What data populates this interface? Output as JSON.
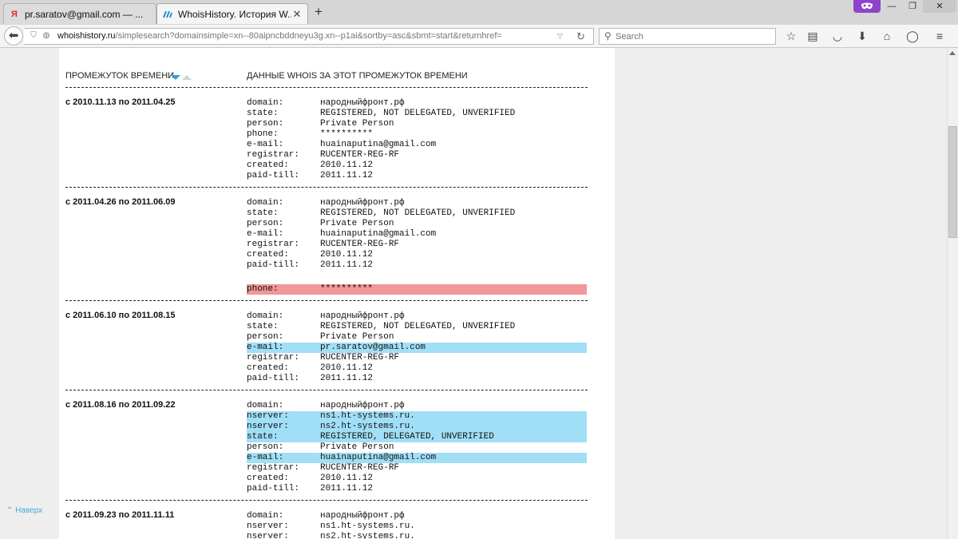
{
  "tabs": [
    {
      "label": "pr.saratov@gmail.com — ...",
      "favicon": "yandex-icon",
      "active": false
    },
    {
      "label": "WhoisHistory. История W...",
      "favicon": "whoishistory-icon",
      "active": true
    }
  ],
  "window_controls": {
    "minimize": "—",
    "restore": "❐",
    "close": "✕"
  },
  "url": {
    "host": "whoishistory.ru",
    "path": "/simplesearch?domainsimple=xn--80aipncbddneyu3g.xn--p1ai&sortby=asc&sbmt=start&returnhref="
  },
  "search": {
    "placeholder": "Search"
  },
  "toolbar_icons": [
    "bookmark-star-icon",
    "reading-list-icon",
    "pocket-icon",
    "download-icon",
    "home-icon",
    "chat-icon",
    "menu-icon"
  ],
  "table": {
    "col_period": "ПРОМЕЖУТОК ВРЕМЕНИ",
    "col_data": "ДАННЫЕ WHOIS ЗА ЭТОТ ПРОМЕЖУТОК ВРЕМЕНИ"
  },
  "records": [
    {
      "period": "с 2010.11.13 по 2011.04.25",
      "rows": [
        {
          "k": "domain:",
          "v": "народныйфронт.рф"
        },
        {
          "k": "state:",
          "v": "REGISTERED, NOT DELEGATED, UNVERIFIED"
        },
        {
          "k": "person:",
          "v": "Private Person"
        },
        {
          "k": "phone:",
          "v": "**********"
        },
        {
          "k": "e-mail:",
          "v": "huainaputina@gmail.com"
        },
        {
          "k": "registrar:",
          "v": "RUCENTER-REG-RF"
        },
        {
          "k": "created:",
          "v": "2010.11.12"
        },
        {
          "k": "paid-till:",
          "v": "2011.11.12"
        }
      ]
    },
    {
      "period": "с 2011.04.26 по 2011.06.09",
      "rows": [
        {
          "k": "domain:",
          "v": "народныйфронт.рф"
        },
        {
          "k": "state:",
          "v": "REGISTERED, NOT DELEGATED, UNVERIFIED"
        },
        {
          "k": "person:",
          "v": "Private Person"
        },
        {
          "k": "e-mail:",
          "v": "huainaputina@gmail.com"
        },
        {
          "k": "registrar:",
          "v": "RUCENTER-REG-RF"
        },
        {
          "k": "created:",
          "v": "2010.11.12"
        },
        {
          "k": "paid-till:",
          "v": "2011.11.12"
        },
        {
          "k": "",
          "v": ""
        },
        {
          "k": "phone:",
          "v": "**********",
          "hl": "red"
        }
      ]
    },
    {
      "period": "с 2011.06.10 по 2011.08.15",
      "rows": [
        {
          "k": "domain:",
          "v": "народныйфронт.рф"
        },
        {
          "k": "state:",
          "v": "REGISTERED, NOT DELEGATED, UNVERIFIED"
        },
        {
          "k": "person:",
          "v": "Private Person"
        },
        {
          "k": "e-mail:",
          "v": "pr.saratov@gmail.com",
          "hl": "blue"
        },
        {
          "k": "registrar:",
          "v": "RUCENTER-REG-RF"
        },
        {
          "k": "created:",
          "v": "2010.11.12"
        },
        {
          "k": "paid-till:",
          "v": "2011.11.12"
        }
      ]
    },
    {
      "period": "с 2011.08.16 по 2011.09.22",
      "rows": [
        {
          "k": "domain:",
          "v": "народныйфронт.рф"
        },
        {
          "k": "nserver:",
          "v": "ns1.ht-systems.ru.",
          "hl": "blue"
        },
        {
          "k": "nserver:",
          "v": "ns2.ht-systems.ru.",
          "hl": "blue"
        },
        {
          "k": "state:",
          "v": "REGISTERED, DELEGATED, UNVERIFIED",
          "hl": "blue"
        },
        {
          "k": "person:",
          "v": "Private Person"
        },
        {
          "k": "e-mail:",
          "v": "huainaputina@gmail.com",
          "hl": "blue"
        },
        {
          "k": "registrar:",
          "v": "RUCENTER-REG-RF"
        },
        {
          "k": "created:",
          "v": "2010.11.12"
        },
        {
          "k": "paid-till:",
          "v": "2011.11.12"
        }
      ]
    },
    {
      "period": "с 2011.09.23 по 2011.11.11",
      "rows": [
        {
          "k": "domain:",
          "v": "народныйфронт.рф"
        },
        {
          "k": "nserver:",
          "v": "ns1.ht-systems.ru."
        },
        {
          "k": "nserver:",
          "v": "ns2.ht-systems.ru."
        }
      ]
    }
  ],
  "back_to_top": "Наверх",
  "colors": {
    "highlight_removed": "#f09797",
    "highlight_changed": "#a1dff7",
    "accent": "#4aa9d8"
  }
}
